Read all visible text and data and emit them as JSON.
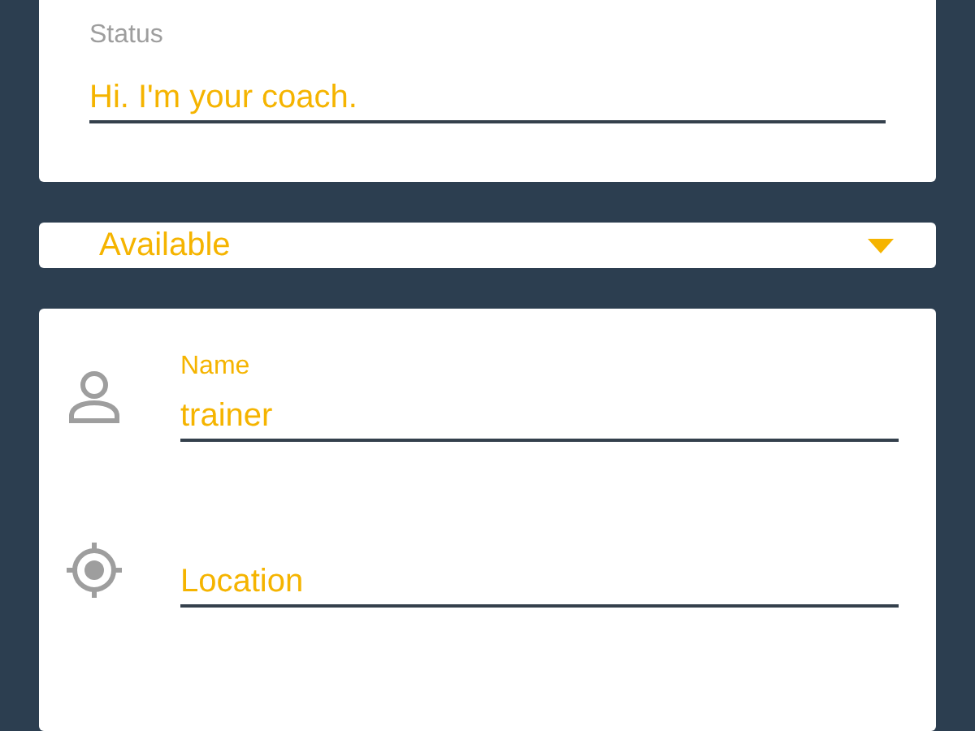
{
  "status": {
    "label": "Status",
    "value": "Hi. I'm your coach."
  },
  "availability": {
    "value": "Available"
  },
  "profile_fields": [
    {
      "kind": "person",
      "label": "Name",
      "value": "trainer"
    },
    {
      "kind": "location",
      "placeholder": "Location"
    }
  ]
}
